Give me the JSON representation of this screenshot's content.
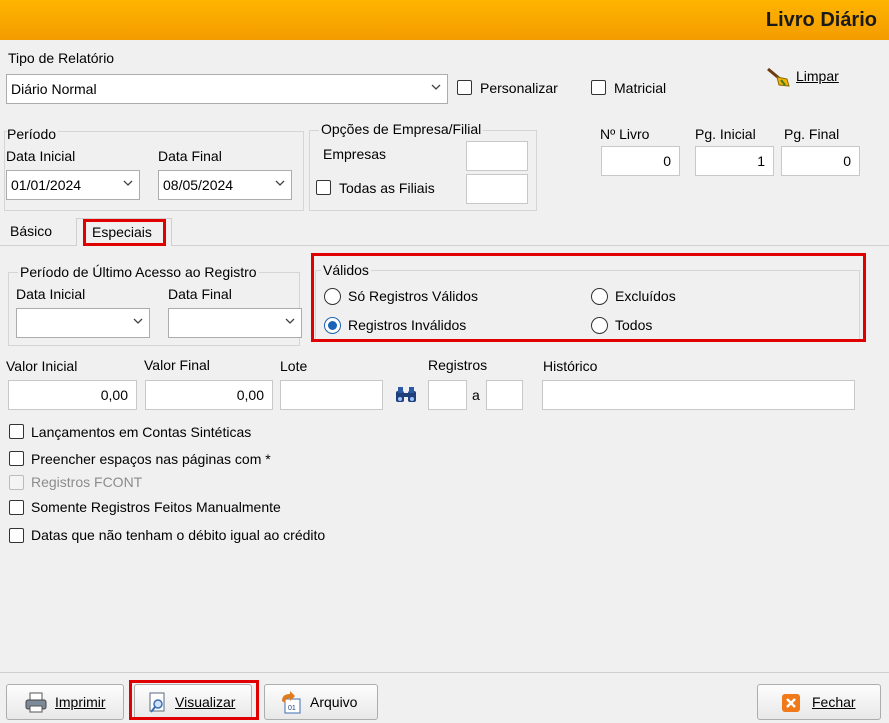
{
  "window": {
    "title": "Livro Diário"
  },
  "top": {
    "tipo_label": "Tipo de Relatório",
    "tipo_value": "Diário Normal",
    "personalizar": "Personalizar",
    "matricial": "Matricial",
    "limpar": "Limpar"
  },
  "periodo": {
    "legend": "Período",
    "data_inicial_label": "Data Inicial",
    "data_final_label": "Data Final",
    "data_inicial": "01/01/2024",
    "data_final": "08/05/2024"
  },
  "opcoes": {
    "legend": "Opções de Empresa/Filial",
    "empresas": "Empresas",
    "todas_filiais": "Todas as Filiais"
  },
  "livro": {
    "n_livro_label": "Nº Livro",
    "pg_inicial_label": "Pg. Inicial",
    "pg_final_label": "Pg. Final",
    "n_livro": "0",
    "pg_inicial": "1",
    "pg_final": "0"
  },
  "tabs": {
    "basico": "Básico",
    "especiais": "Especiais"
  },
  "ultimo_acesso": {
    "legend": "Período de Último Acesso ao Registro",
    "data_inicial_label": "Data Inicial",
    "data_final_label": "Data Final"
  },
  "validos": {
    "legend": "Válidos",
    "so_validos": "Só Registros Válidos",
    "invalidos": "Registros Inválidos",
    "excluidos": "Excluídos",
    "todos": "Todos",
    "selected": "invalidos"
  },
  "filtros": {
    "valor_inicial_label": "Valor Inicial",
    "valor_final_label": "Valor Final",
    "lote_label": "Lote",
    "registros_label": "Registros",
    "historico_label": "Histórico",
    "valor_inicial": "0,00",
    "valor_final": "0,00",
    "a": "a"
  },
  "checks": {
    "sinteticas": "Lançamentos em Contas Sintéticas",
    "preencher": "Preencher espaços nas páginas com *",
    "fcont": "Registros FCONT",
    "manual": "Somente Registros Feitos Manualmente",
    "debito": "Datas que não tenham o débito igual ao crédito"
  },
  "buttons": {
    "imprimir": "Imprimir",
    "visualizar": "Visualizar",
    "arquivo": "Arquivo",
    "fechar": "Fechar"
  },
  "colors": {
    "header": "#f5a300",
    "highlight": "#e00000",
    "radio": "#1a63b8"
  }
}
